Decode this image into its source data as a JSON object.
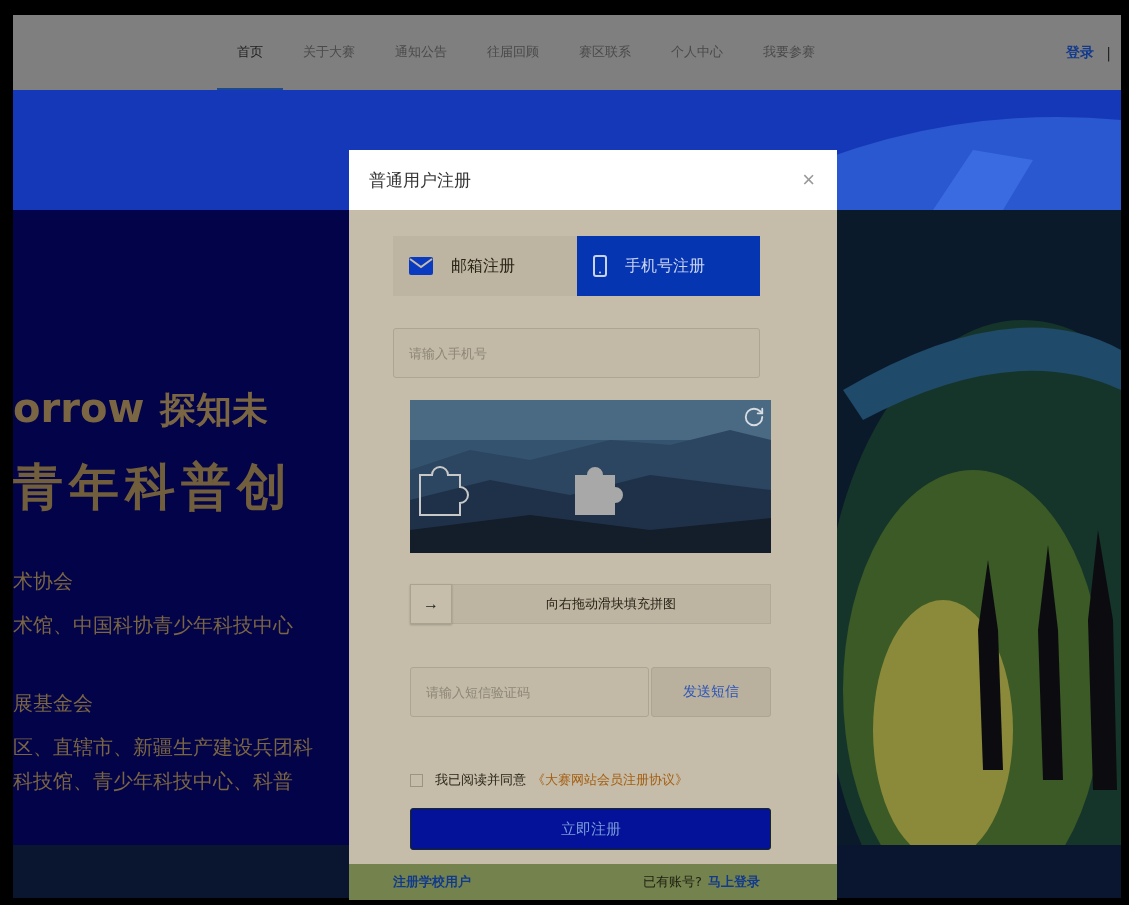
{
  "nav": {
    "items": [
      {
        "label": "首页",
        "selected": true
      },
      {
        "label": "关于大赛",
        "selected": false
      },
      {
        "label": "通知公告",
        "selected": false
      },
      {
        "label": "往届回顾",
        "selected": false
      },
      {
        "label": "赛区联系",
        "selected": false
      },
      {
        "label": "个人中心",
        "selected": false
      },
      {
        "label": "我要参赛",
        "selected": false
      }
    ],
    "login": "登录",
    "separator": "|"
  },
  "banner": {
    "logo_text": "orrow",
    "logo_cn": "探知未",
    "headline": "青年科普创",
    "lines": [
      "术协会",
      "术馆、中国科协青少年科技中心",
      "展基金会",
      "区、直辖市、新疆生产建设兵团科",
      "科技馆、青少年科技中心、科普"
    ]
  },
  "modal": {
    "title": "普通用户注册",
    "close": "×",
    "tabs": [
      {
        "label": "邮箱注册",
        "selected": false,
        "kind": "email"
      },
      {
        "label": "手机号注册",
        "selected": true,
        "kind": "phone"
      }
    ],
    "phone_field": {
      "placeholder": "请输入手机号"
    },
    "slider": {
      "arrow": "→",
      "label": "向右拖动滑块填充拼图",
      "level": 0
    },
    "sms_field": {
      "placeholder": "请输入短信验证码"
    },
    "send_button": "发送短信",
    "agreement": {
      "checked": false,
      "text": "我已阅读并同意",
      "link": "《大赛网站会员注册协议》"
    },
    "submit": "立即注册",
    "school_link": "注册学校用户",
    "have_account": "已有账号?",
    "login_link": "马上登录"
  }
}
